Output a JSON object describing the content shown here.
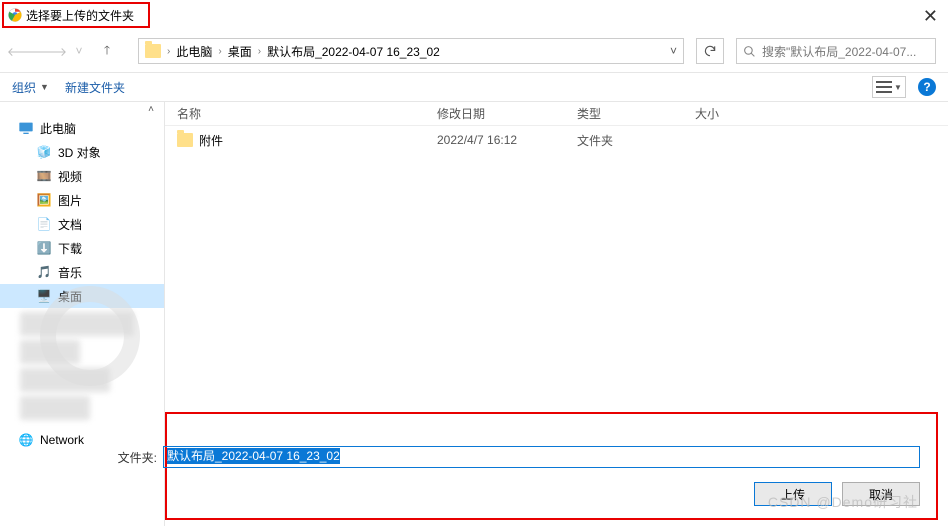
{
  "title": "选择要上传的文件夹",
  "breadcrumbs": [
    "此电脑",
    "桌面",
    "默认布局_2022-04-07 16_23_02"
  ],
  "search_placeholder": "搜索\"默认布局_2022-04-07...",
  "toolbar": {
    "organize": "组织",
    "new_folder": "新建文件夹"
  },
  "columns": {
    "name": "名称",
    "date": "修改日期",
    "type": "类型",
    "size": "大小"
  },
  "sidebar": {
    "root": "此电脑",
    "items": [
      "3D 对象",
      "视频",
      "图片",
      "文档",
      "下载",
      "音乐",
      "桌面"
    ],
    "network": "Network"
  },
  "files": [
    {
      "name": "附件",
      "date": "2022/4/7 16:12",
      "type": "文件夹"
    }
  ],
  "footer": {
    "label": "文件夹:",
    "value": "默认布局_2022-04-07 16_23_02",
    "upload": "上传",
    "cancel": "取消"
  },
  "watermark": "CSDN @Demo研习社"
}
